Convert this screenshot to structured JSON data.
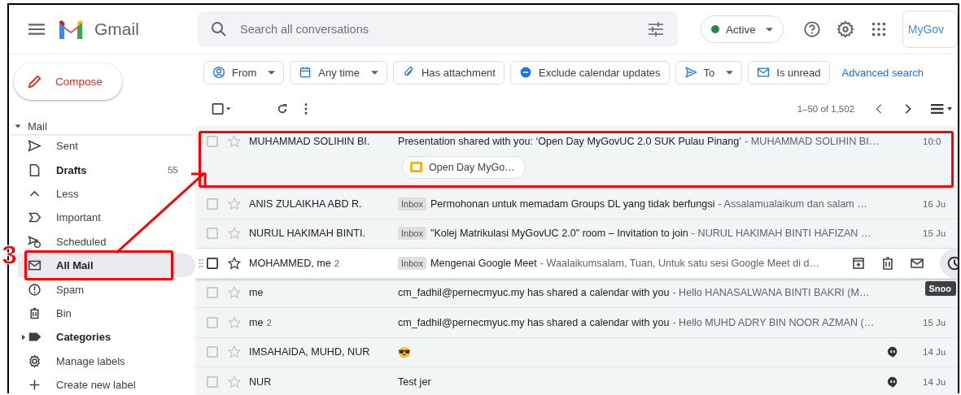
{
  "header": {
    "app_name": "Gmail",
    "search": {
      "placeholder": "Search all conversations"
    },
    "status": {
      "label": "Active",
      "color": "#1e8e3e"
    },
    "account": "MyGov"
  },
  "sidebar": {
    "compose": "Compose",
    "section": {
      "label": "Mail",
      "expanded": true
    },
    "items": [
      {
        "label": "Sent",
        "bold": false,
        "selected": false,
        "highlighted": false
      },
      {
        "label": "Drafts",
        "count": "55",
        "bold": true,
        "selected": false,
        "highlighted": false
      },
      {
        "label": "Less",
        "bold": false,
        "selected": false,
        "highlighted": false
      },
      {
        "label": "Important",
        "bold": false,
        "selected": false,
        "highlighted": false
      },
      {
        "label": "Scheduled",
        "bold": false,
        "selected": false,
        "highlighted": false
      },
      {
        "label": "All Mail",
        "bold": true,
        "selected": true,
        "highlighted": true
      },
      {
        "label": "Spam",
        "bold": false,
        "selected": false,
        "highlighted": false
      },
      {
        "label": "Bin",
        "bold": false,
        "selected": false,
        "highlighted": false
      },
      {
        "label": "Categories",
        "bold": true,
        "selected": false,
        "highlighted": false,
        "expanded": false
      },
      {
        "label": "Manage labels",
        "bold": false,
        "selected": false,
        "highlighted": false
      },
      {
        "label": "Create new label",
        "bold": false,
        "selected": false,
        "highlighted": false
      }
    ]
  },
  "filters": [
    {
      "label": "From",
      "dropdown": true
    },
    {
      "label": "Any time",
      "dropdown": true
    },
    {
      "label": "Has attachment",
      "dropdown": false
    },
    {
      "label": "Exclude calendar updates",
      "dropdown": false
    },
    {
      "label": "To",
      "dropdown": true
    },
    {
      "label": "Is unread",
      "dropdown": false
    }
  ],
  "advanced_search": "Advanced search",
  "toolbar": {
    "range": "1–50 of 1,502"
  },
  "rows": [
    {
      "sender": "MUHAMMAD SOLIHIN BI.",
      "subject": "Presentation shared with you: ‘Open Day MyGovUC 2.0 SUK Pulau Pinang’",
      "snippet": "- MUHAMMAD SOLIHIN BI…",
      "date": "10:0",
      "attachment": "Open Day MyGo…",
      "hovered": false,
      "highlighted": true,
      "chat": false
    },
    {
      "sender": "ANIS ZULAIKHA ABD R.",
      "label": "Inbox",
      "subject": "Permohonan untuk memadam Groups DL yang tidak berfungsi",
      "snippet": "- Assalamualaikum dan salam …",
      "date": "16 Ju",
      "hovered": false,
      "highlighted": false,
      "chat": false
    },
    {
      "sender": "NURUL HAKIMAH BINTI.",
      "label": "Inbox",
      "subject": "\"Kolej Matrikulasi MyGovUC 2.0\" room – Invitation to join",
      "snippet": "- NURUL HAKIMAH BINTI HAFIZAN …",
      "date": "15 Ju",
      "hovered": false,
      "highlighted": false,
      "chat": false
    },
    {
      "sender": "MOHAMMED, me",
      "count": "2",
      "label": "Inbox",
      "subject": "Mengenai Google Meet",
      "snippet": "- Waalaikumsalam, Tuan, Untuk satu sesi Google Meet di d…",
      "hovered": true,
      "highlighted": false,
      "chat": false,
      "tooltip": "Snoo"
    },
    {
      "sender": "me",
      "subject": "cm_fadhil@pernecmyuc.my has shared a calendar with you",
      "snippet": "- Hello HANASALWANA BINTI BAKRI (M…",
      "hovered": false,
      "highlighted": false,
      "chat": false
    },
    {
      "sender": "me",
      "count": "2",
      "subject": "cm_fadhil@pernecmyuc.my has shared a calendar with you",
      "snippet": "- Hello MUHD ADRY BIN NOOR AZMAN (…",
      "date": "15 Ju",
      "hovered": false,
      "highlighted": false,
      "chat": false
    },
    {
      "sender": "IMSAHAIDA, MUHD, NUR",
      "subject": "😎",
      "date": "14 Ju",
      "hovered": false,
      "highlighted": false,
      "chat": true
    },
    {
      "sender": "NUR",
      "subject": "Test jer",
      "date": "14 Ju",
      "hovered": false,
      "highlighted": false,
      "chat": true
    }
  ],
  "annotations": [
    {
      "kind": "number",
      "text": "3"
    },
    {
      "kind": "arrow"
    }
  ]
}
